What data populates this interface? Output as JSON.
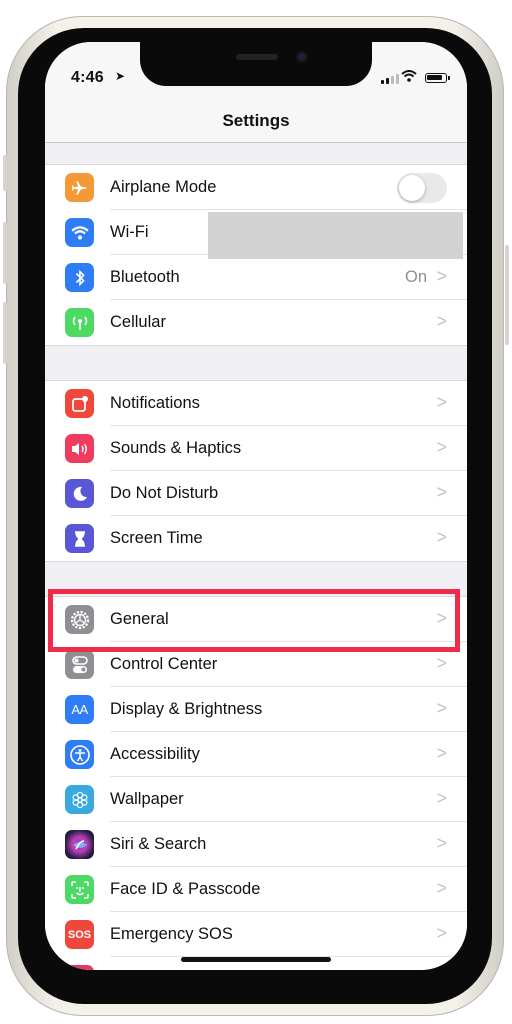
{
  "status_bar": {
    "time": "4:46",
    "location_icon": "location-arrow-icon",
    "signal_icon": "cellular-signal-icon",
    "wifi_icon": "wifi-icon",
    "battery_icon": "battery-icon"
  },
  "nav": {
    "title": "Settings"
  },
  "groups": [
    {
      "rows": [
        {
          "label": "Airplane Mode",
          "icon": "airplane-icon",
          "icon_color": "#f29a38",
          "glyph": "✈",
          "control": "toggle",
          "toggle_on": false
        },
        {
          "label": "Wi-Fi",
          "icon": "wifi-icon",
          "icon_color": "#2e7cf6",
          "glyph": "◠",
          "value": "",
          "redacted": true
        },
        {
          "label": "Bluetooth",
          "icon": "bluetooth-icon",
          "icon_color": "#2e7cf6",
          "glyph": "ᛒ",
          "value": "On",
          "chevron": ">"
        },
        {
          "label": "Cellular",
          "icon": "cellular-antenna-icon",
          "icon_color": "#4cd964",
          "glyph": "((•))",
          "chevron": ">"
        }
      ]
    },
    {
      "rows": [
        {
          "label": "Notifications",
          "icon": "notifications-icon",
          "icon_color": "#f0473b",
          "glyph": "◰",
          "chevron": ">"
        },
        {
          "label": "Sounds & Haptics",
          "icon": "speaker-icon",
          "icon_color": "#f03b5f",
          "glyph": "🔊",
          "chevron": ">"
        },
        {
          "label": "Do Not Disturb",
          "icon": "moon-icon",
          "icon_color": "#5957d6",
          "glyph": "☾",
          "chevron": ">"
        },
        {
          "label": "Screen Time",
          "icon": "hourglass-icon",
          "icon_color": "#5957d6",
          "glyph": "⧗",
          "chevron": ">"
        }
      ]
    },
    {
      "rows": [
        {
          "label": "General",
          "icon": "gear-icon",
          "icon_color": "#8e8e93",
          "glyph": "⚙",
          "chevron": ">",
          "highlighted": true
        },
        {
          "label": "Control Center",
          "icon": "switches-icon",
          "icon_color": "#8e8e93",
          "glyph": "⊜",
          "chevron": ">"
        },
        {
          "label": "Display & Brightness",
          "icon": "text-size-icon",
          "icon_color": "#2e7cf6",
          "glyph": "AA",
          "chevron": ">"
        },
        {
          "label": "Accessibility",
          "icon": "accessibility-icon",
          "icon_color": "#2e7cf6",
          "glyph": "♿",
          "chevron": ">"
        },
        {
          "label": "Wallpaper",
          "icon": "flower-icon",
          "icon_color": "#39a9e0",
          "glyph": "❀",
          "chevron": ">"
        },
        {
          "label": "Siri & Search",
          "icon": "siri-icon",
          "icon_color": "#2a1d4f",
          "glyph": "✦",
          "chevron": ">"
        },
        {
          "label": "Face ID & Passcode",
          "icon": "face-id-icon",
          "icon_color": "#4cd964",
          "glyph": "☺",
          "chevron": ">"
        },
        {
          "label": "Emergency SOS",
          "icon": "sos-icon",
          "icon_color": "#f0473b",
          "glyph": "SOS",
          "chevron": ">"
        }
      ]
    }
  ],
  "annotation": {
    "highlight_color": "#ee2b48",
    "highlighted_item": "General"
  }
}
